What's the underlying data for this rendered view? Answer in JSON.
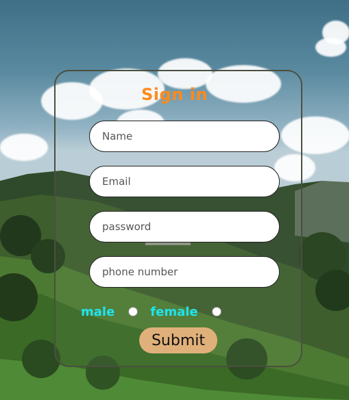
{
  "form": {
    "title": "Sign in",
    "fields": {
      "name_placeholder": "Name",
      "email_placeholder": "Email",
      "password_placeholder": "password",
      "phone_placeholder": "phone number"
    },
    "gender": {
      "male_label": "male",
      "female_label": "female"
    },
    "submit_label": "Submit"
  },
  "colors": {
    "title": "#ff8a1a",
    "gender_label": "#20e4f0",
    "submit_bg": "#e0b07a",
    "card_border": "#4b4f3f"
  }
}
